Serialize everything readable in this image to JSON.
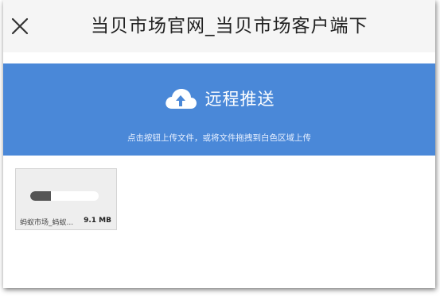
{
  "header": {
    "title": "当贝市场官网_当贝市场客户端下",
    "close_icon": "close-icon"
  },
  "banner": {
    "icon": "cloud-upload-icon",
    "heading": "远程推送",
    "hint": "点击按钮上传文件，或将文件拖拽到白色区域上传",
    "color": "#4a88d8"
  },
  "files": [
    {
      "name": "蚂蚁市场_蚂蚁...",
      "size": "9.1 MB",
      "progress": 0.3
    }
  ]
}
